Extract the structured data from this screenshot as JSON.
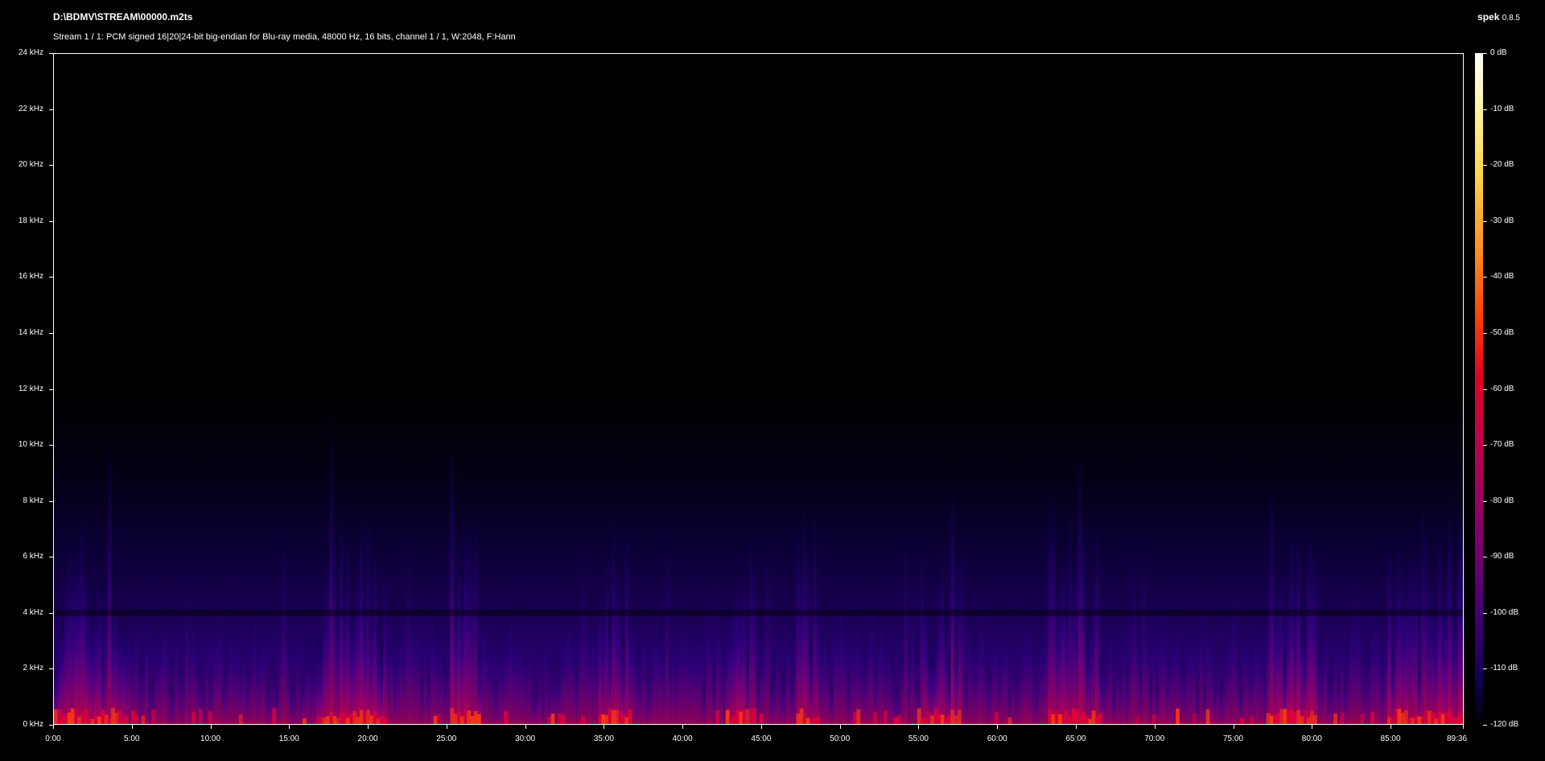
{
  "header": {
    "file_path": "D:\\BDMV\\STREAM\\00000.m2ts",
    "stream_info": "Stream 1 / 1: PCM signed 16|20|24-bit big-endian for Blu-ray media, 48000 Hz, 16 bits, channel 1 / 1, W:2048, F:Hann",
    "app_name": "spek",
    "app_version": "0.8.5"
  },
  "chart_data": {
    "type": "heatmap",
    "title": "D:\\BDMV\\STREAM\\00000.m2ts",
    "subtitle": "Stream 1 / 1: PCM signed 16|20|24-bit big-endian for Blu-ray media, 48000 Hz, 16 bits, channel 1 / 1, W:2048, F:Hann",
    "x_axis": {
      "unit": "time",
      "range": [
        "0:00",
        "89:36"
      ],
      "ticks": [
        "0:00",
        "5:00",
        "10:00",
        "15:00",
        "20:00",
        "25:00",
        "30:00",
        "35:00",
        "40:00",
        "45:00",
        "50:00",
        "55:00",
        "60:00",
        "65:00",
        "70:00",
        "75:00",
        "80:00",
        "85:00",
        "89:36"
      ]
    },
    "y_axis": {
      "unit": "kHz",
      "range": [
        0,
        24
      ],
      "ticks": [
        "0 kHz",
        "2 kHz",
        "4 kHz",
        "6 kHz",
        "8 kHz",
        "10 kHz",
        "12 kHz",
        "14 kHz",
        "16 kHz",
        "18 kHz",
        "20 kHz",
        "22 kHz",
        "24 kHz"
      ]
    },
    "colorbar": {
      "unit": "dB",
      "range": [
        -120,
        0
      ],
      "ticks": [
        "0 dB",
        "-10 dB",
        "-20 dB",
        "-30 dB",
        "-40 dB",
        "-50 dB",
        "-60 dB",
        "-70 dB",
        "-80 dB",
        "-90 dB",
        "-100 dB",
        "-110 dB",
        "-120 dB"
      ]
    },
    "colors": {
      "background": "#000000",
      "low": "#1a0066",
      "mid": "#a0007a",
      "high": "#ff2a10",
      "peak": "#ffffff"
    },
    "content_cutoff_khz_approx": 10,
    "loud_segments_minutes": [
      [
        0,
        4.5
      ],
      [
        16.5,
        21
      ],
      [
        25,
        27
      ],
      [
        34.5,
        36.5
      ],
      [
        42.5,
        44.5
      ],
      [
        47,
        48.5
      ],
      [
        55,
        57.5
      ],
      [
        63,
        66.5
      ],
      [
        77,
        80
      ],
      [
        84.5,
        89.6
      ]
    ]
  }
}
